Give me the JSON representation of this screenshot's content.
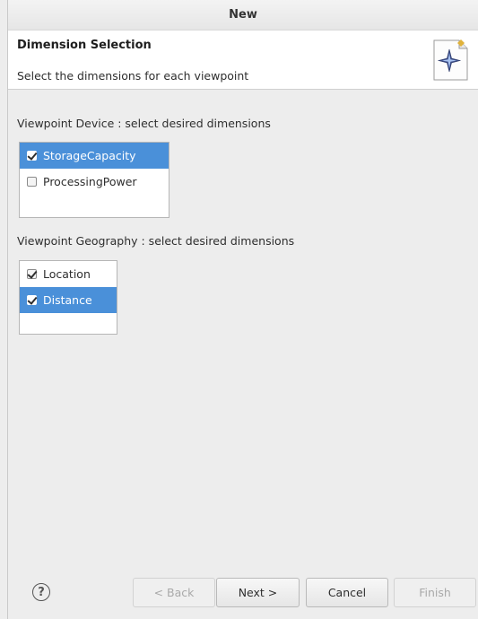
{
  "window": {
    "title": "New"
  },
  "header": {
    "title": "Dimension Selection",
    "description": "Select the dimensions for each viewpoint",
    "icon": "wizard-diamond-icon"
  },
  "sections": [
    {
      "label": "Viewpoint Device : select desired dimensions",
      "items": [
        {
          "label": "StorageCapacity",
          "checked": true,
          "selected": true
        },
        {
          "label": "ProcessingPower",
          "checked": false,
          "selected": false
        }
      ]
    },
    {
      "label": "Viewpoint Geography : select desired dimensions",
      "items": [
        {
          "label": "Location",
          "checked": true,
          "selected": false
        },
        {
          "label": "Distance",
          "checked": true,
          "selected": true
        }
      ]
    }
  ],
  "footer": {
    "help_icon": "?",
    "back_label": "< Back",
    "next_label": "Next >",
    "cancel_label": "Cancel",
    "finish_label": "Finish"
  },
  "colors": {
    "selection": "#4a90d9",
    "header_bg": "#ffffff",
    "body_bg": "#ededed"
  }
}
